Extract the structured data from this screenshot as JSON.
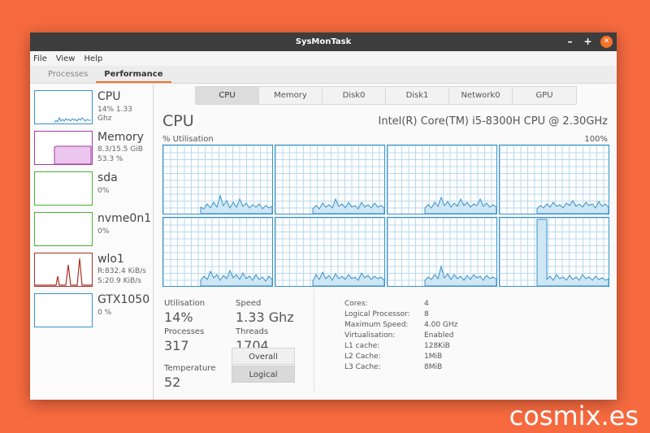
{
  "window": {
    "title": "SysMonTask",
    "close_glyph": "✕",
    "min_glyph": "–",
    "max_glyph": "+"
  },
  "menu": [
    "File",
    "View",
    "Help"
  ],
  "tabs": [
    "Processes",
    "Performance"
  ],
  "sidebar": [
    {
      "name": "CPU",
      "lines": [
        "14% 1.33 Ghz"
      ],
      "color": "#3892c9"
    },
    {
      "name": "Memory",
      "lines": [
        "8.3/15.5 GiB",
        "53.3 %"
      ],
      "color": "#a23ca5"
    },
    {
      "name": "sda",
      "lines": [
        "0%"
      ],
      "color": "#4caf3a"
    },
    {
      "name": "nvme0n1",
      "lines": [
        "0%"
      ],
      "color": "#4caf3a"
    },
    {
      "name": "wlo1",
      "lines": [
        "R:832.4 KiB/s",
        "S:20.9 KiB/s"
      ],
      "color": "#a8312a"
    },
    {
      "name": "GTX1050",
      "lines": [
        "0 %"
      ],
      "color": "#3892c9"
    }
  ],
  "subtabs": [
    "CPU",
    "Memory",
    "Disk0",
    "Disk1",
    "Network0",
    "GPU"
  ],
  "cpu": {
    "title": "CPU",
    "model": "Intel(R) Core(TM) i5-8300H CPU @ 2.30GHz",
    "util_label": "% Utilisation",
    "util_max": "100%"
  },
  "stats": {
    "utilisation_label": "Utilisation",
    "utilisation": "14%",
    "speed_label": "Speed",
    "speed": "1.33 Ghz",
    "processes_label": "Processes",
    "processes": "317",
    "threads_label": "Threads",
    "threads": "1704",
    "temperature_label": "Temperature",
    "temperature": "52"
  },
  "buttons": {
    "overall": "Overall",
    "logical": "Logical"
  },
  "info": [
    {
      "k": "Cores:",
      "v": "4"
    },
    {
      "k": "Logical Processor:",
      "v": "8"
    },
    {
      "k": "Maximum Speed:",
      "v": "4.00 GHz"
    },
    {
      "k": "Virtualisation:",
      "v": "Enabled"
    },
    {
      "k": "L1 cache:",
      "v": "128KiB"
    },
    {
      "k": "L2 Cache:",
      "v": "1MiB"
    },
    {
      "k": "L3 Cache:",
      "v": "8MiB"
    }
  ],
  "watermark": "cosmix.es"
}
